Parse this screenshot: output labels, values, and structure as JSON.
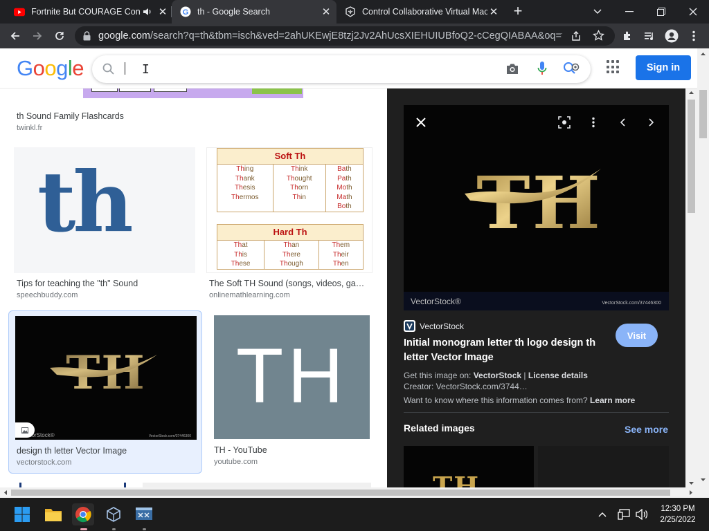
{
  "tabs": [
    {
      "title": "Fortnite But COURAGE Contro",
      "favicon": "youtube-icon"
    },
    {
      "title": "th - Google Search",
      "favicon": "google-icon"
    },
    {
      "title": "Control Collaborative Virtual Mach",
      "favicon": "virtualbox-icon"
    }
  ],
  "address": {
    "host": "google.com",
    "path": "/search?q=th&tbm=isch&ved=2ahUKEwjE8tzj2Jv2AhUcsXIEHUIUBfoQ2-cCegQIABAA&oq=th&..."
  },
  "google": {
    "logo_letters": [
      {
        "ch": "G",
        "color": "#4285F4"
      },
      {
        "ch": "o",
        "color": "#EA4335"
      },
      {
        "ch": "o",
        "color": "#FBBC05"
      },
      {
        "ch": "g",
        "color": "#4285F4"
      },
      {
        "ch": "l",
        "color": "#34A853"
      },
      {
        "ch": "e",
        "color": "#EA4335"
      }
    ],
    "search_value": "",
    "sign_in": "Sign in"
  },
  "results": [
    {
      "title": "th Sound Family Flashcards",
      "source": "twinkl.fr"
    },
    {
      "title": "Tips for teaching the \"th\" Sound",
      "source": "speechbuddy.com",
      "thumb_text": "th"
    },
    {
      "title": "The Soft TH Sound (songs, videos, game...",
      "source": "onlinemathlearning.com"
    },
    {
      "title": "design th letter Vector Image",
      "source": "vectorstock.com",
      "thumb_text": "TH",
      "watermark": "VectorStock®",
      "watermark_url": "VectorStock.com/37446300"
    },
    {
      "title": "TH - YouTube",
      "source": "youtube.com",
      "thumb_text": "TH"
    }
  ],
  "soft_th_table": {
    "soft_header": "Soft Th",
    "soft_cols": [
      [
        "Thing",
        "Thank",
        "Thesis",
        "Thermos"
      ],
      [
        "Think",
        "Thought",
        "Thorn",
        "Thin"
      ],
      [
        "Bath",
        "Path",
        "Moth",
        "Math",
        "Both"
      ]
    ],
    "hard_header": "Hard Th",
    "hard_cols": [
      [
        "That",
        "This",
        "These"
      ],
      [
        "Than",
        "There",
        "Though"
      ],
      [
        "Them",
        "Their",
        "Then"
      ]
    ]
  },
  "preview": {
    "image_text": "TH",
    "watermark": "VectorStock®",
    "watermark_url": "VectorStock.com/37446300",
    "site_name": "VectorStock",
    "title": "Initial monogram letter th logo design th letter Vector Image",
    "visit": "Visit",
    "get_image_prefix": "Get this image on: ",
    "get_image_site": "VectorStock",
    "license_sep": " | ",
    "license": "License details",
    "creator": "Creator: VectorStock.com/3744…",
    "info_question": "Want to know where this information comes from? ",
    "learn_more": "Learn more",
    "related": "Related images",
    "see_more": "See more",
    "related_thumb_text": "TH"
  },
  "taskbar": {
    "time": "12:30 PM",
    "date": "2/25/2022"
  },
  "colors": {
    "accent": "#1a73e8",
    "panel_bg": "#1f1f1f",
    "link_blue": "#8ab4f8",
    "gold": "#c9a54e",
    "selected_card": "#e8f0fe"
  }
}
